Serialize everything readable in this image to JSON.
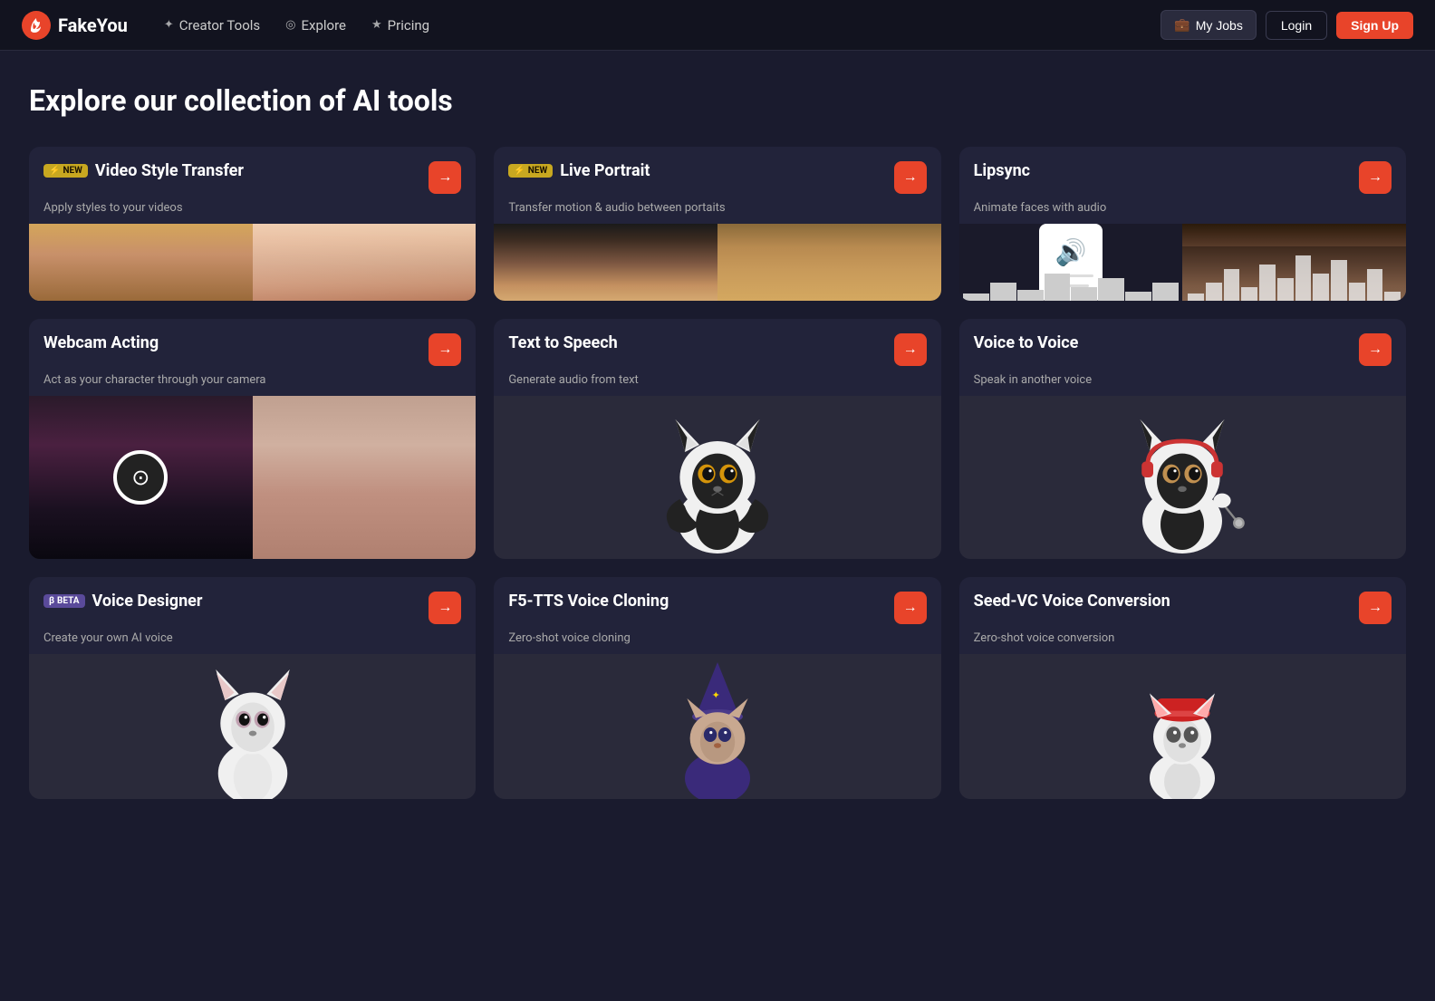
{
  "nav": {
    "logo_text": "FakeYou",
    "links": [
      {
        "id": "creator-tools",
        "label": "Creator Tools",
        "icon": "✦"
      },
      {
        "id": "explore",
        "label": "Explore",
        "icon": "◎"
      },
      {
        "id": "pricing",
        "label": "Pricing",
        "icon": "★"
      }
    ],
    "my_jobs_label": "My Jobs",
    "login_label": "Login",
    "signup_label": "Sign Up"
  },
  "page": {
    "title": "Explore our collection of AI tools"
  },
  "tools": [
    {
      "id": "video-style-transfer",
      "badge": "NEW",
      "badge_type": "new",
      "title": "Video Style Transfer",
      "subtitle": "Apply styles to your videos",
      "image_type": "video-style"
    },
    {
      "id": "live-portrait",
      "badge": "NEW",
      "badge_type": "new",
      "title": "Live Portrait",
      "subtitle": "Transfer motion & audio between portaits",
      "image_type": "live-portrait"
    },
    {
      "id": "lipsync",
      "badge": null,
      "badge_type": null,
      "title": "Lipsync",
      "subtitle": "Animate faces with audio",
      "image_type": "lipsync"
    },
    {
      "id": "webcam-acting",
      "badge": null,
      "badge_type": null,
      "title": "Webcam Acting",
      "subtitle": "Act as your character through your camera",
      "image_type": "webcam"
    },
    {
      "id": "text-to-speech",
      "badge": null,
      "badge_type": null,
      "title": "Text to Speech",
      "subtitle": "Generate audio from text",
      "image_type": "tts"
    },
    {
      "id": "voice-to-voice",
      "badge": null,
      "badge_type": null,
      "title": "Voice to Voice",
      "subtitle": "Speak in another voice",
      "image_type": "v2v"
    },
    {
      "id": "voice-designer",
      "badge": "BETA",
      "badge_type": "beta",
      "title": "Voice Designer",
      "subtitle": "Create your own AI voice",
      "image_type": "voice-designer"
    },
    {
      "id": "f5-tts",
      "badge": null,
      "badge_type": null,
      "title": "F5-TTS Voice Cloning",
      "subtitle": "Zero-shot voice cloning",
      "image_type": "f5"
    },
    {
      "id": "seed-vc",
      "badge": null,
      "badge_type": null,
      "title": "Seed-VC Voice Conversion",
      "subtitle": "Zero-shot voice conversion",
      "image_type": "seed"
    }
  ],
  "icons": {
    "arrow_right": "→",
    "briefcase": "💼",
    "star": "★",
    "compass": "◎",
    "wrench": "✦",
    "lightning": "⚡"
  }
}
